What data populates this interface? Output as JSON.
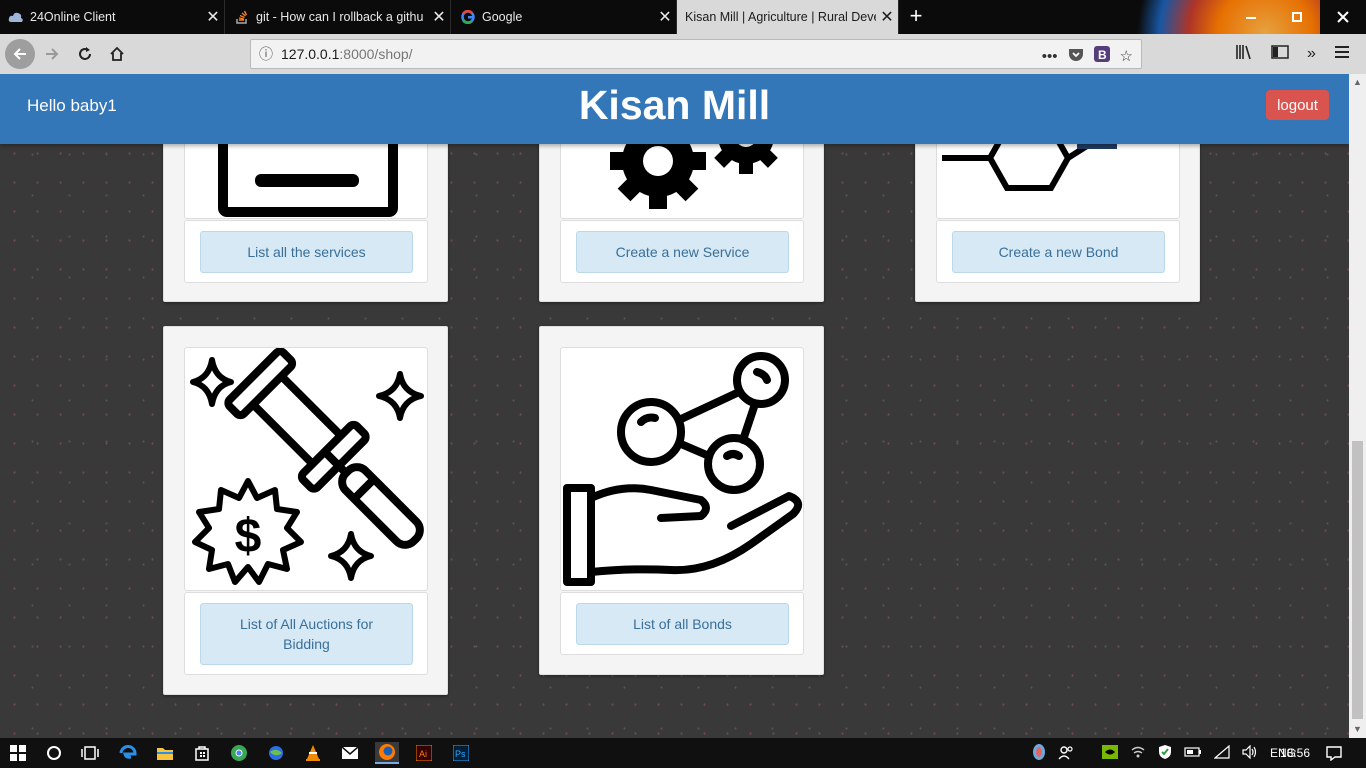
{
  "browser": {
    "tabs": [
      {
        "title": "24Online Client",
        "active": false
      },
      {
        "title": "git - How can I rollback a githu",
        "active": false
      },
      {
        "title": "Google",
        "active": false
      },
      {
        "title": "Kisan Mill | Agriculture | Rural Deve",
        "active": true
      }
    ],
    "url_host": "127.0.0.1",
    "url_path": ":8000/shop/"
  },
  "header": {
    "greeting": "Hello baby1",
    "brand": "Kisan Mill",
    "logout_label": "logout",
    "color": "#3377b8"
  },
  "cards": [
    {
      "label": "List all the services",
      "icon": "id-card-icon"
    },
    {
      "label": "Create a new Service",
      "icon": "gears-icon"
    },
    {
      "label": "Create a new Bond",
      "icon": "hexagon-network-icon"
    },
    {
      "label": "List of All Auctions for Bidding",
      "icon": "auction-gavel-icon"
    },
    {
      "label": "List of all Bonds",
      "icon": "hand-molecule-icon"
    }
  ],
  "taskbar": {
    "language": "ENG",
    "time": "18:56"
  }
}
